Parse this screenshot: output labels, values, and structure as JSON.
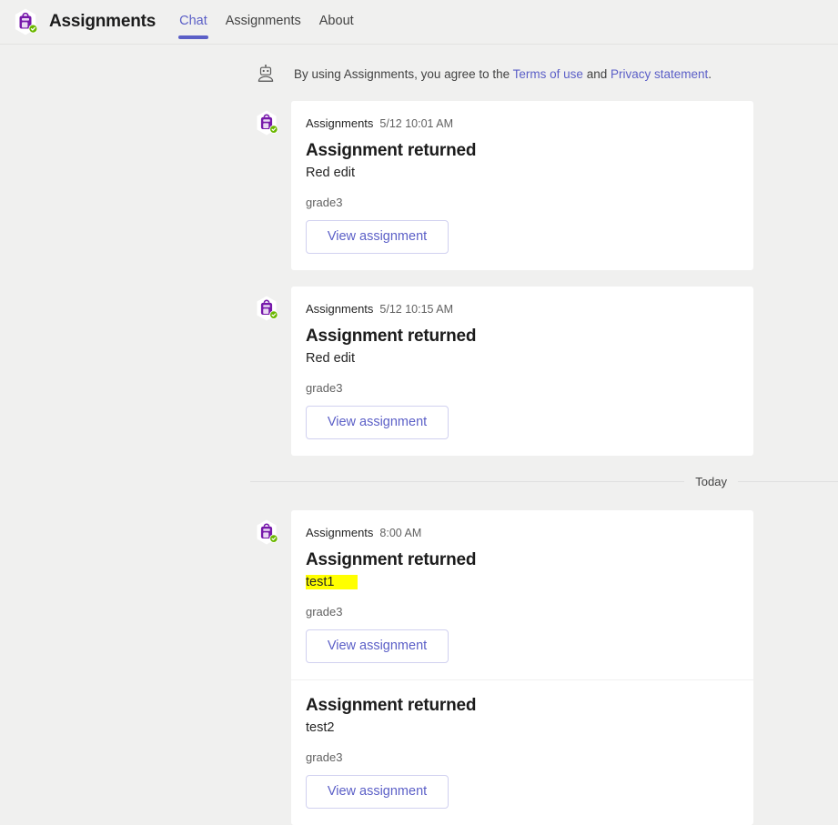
{
  "header": {
    "app_icon": "assignments-backpack-icon",
    "badge_icon": "green-check-badge-icon",
    "title": "Assignments",
    "tabs": [
      {
        "label": "Chat",
        "active": true
      },
      {
        "label": "Assignments",
        "active": false
      },
      {
        "label": "About",
        "active": false
      }
    ]
  },
  "consent": {
    "icon": "bot-icon",
    "prefix": "By using Assignments, you agree to the ",
    "terms_link": "Terms of use",
    "middle": " and ",
    "privacy_link": "Privacy statement",
    "suffix": "."
  },
  "divider": {
    "label": "Today"
  },
  "colors": {
    "accent": "#5b5fc7",
    "link": "#5b5fc7",
    "highlight": "#ffff00",
    "page_background": "#f0f0ef",
    "card_background": "#ffffff",
    "badge_green": "#6bb700",
    "icon_purple": "#7719aa"
  },
  "groups": [
    {
      "avatar": "assignments-backpack-icon",
      "cards": [
        {
          "sender": "Assignments",
          "time": "5/12 10:01 AM",
          "title": "Assignment returned",
          "subtitle": "Red edit",
          "highlighted": false,
          "class_name": "grade3",
          "button_label": "View assignment"
        }
      ]
    },
    {
      "avatar": "assignments-backpack-icon",
      "cards": [
        {
          "sender": "Assignments",
          "time": "5/12 10:15 AM",
          "title": "Assignment returned",
          "subtitle": "Red edit",
          "highlighted": false,
          "class_name": "grade3",
          "button_label": "View assignment"
        }
      ]
    },
    {
      "avatar": "assignments-backpack-icon",
      "cards": [
        {
          "sender": "Assignments",
          "time": "8:00 AM",
          "title": "Assignment returned",
          "subtitle": "test1",
          "highlighted": true,
          "class_name": "grade3",
          "button_label": "View assignment"
        },
        {
          "sender": "",
          "time": "",
          "title": "Assignment returned",
          "subtitle": "test2",
          "highlighted": true,
          "class_name": "grade3",
          "button_label": "View assignment"
        }
      ]
    }
  ]
}
